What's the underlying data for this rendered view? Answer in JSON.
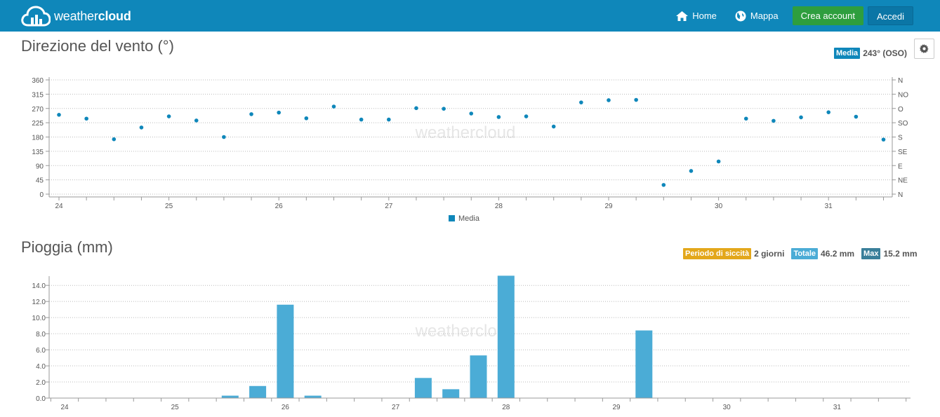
{
  "nav": {
    "brand_light": "weather",
    "brand_bold": "cloud",
    "home_label": "Home",
    "map_label": "Mappa",
    "create_label": "Crea account",
    "login_label": "Accedi"
  },
  "wind": {
    "title": "Direzione del vento (°)",
    "badge_label": "Media",
    "badge_value": "243° (OSO)",
    "badge_color": "#0f87ba"
  },
  "rain": {
    "title": "Pioggia (mm)",
    "dry_label": "Periodo di siccità",
    "dry_value": "2 giorni",
    "dry_color": "#e3a71b",
    "total_label": "Totale",
    "total_value": "46.2 mm",
    "total_color": "#4bacd6",
    "max_label": "Max",
    "max_value": "15.2 mm",
    "max_color": "#3a7f9a"
  },
  "watermark": "weathercloud",
  "chart_data": [
    {
      "type": "scatter",
      "x_ticks": [
        "24",
        "25",
        "26",
        "27",
        "28",
        "29",
        "30",
        "31"
      ],
      "y_ticks": [
        0,
        45,
        90,
        135,
        180,
        225,
        270,
        315,
        360
      ],
      "y2_ticks": [
        "N",
        "NE",
        "E",
        "SE",
        "S",
        "SO",
        "O",
        "NO",
        "N"
      ],
      "ylim": [
        0,
        360
      ],
      "xlim": [
        24,
        31.6
      ],
      "grid": true,
      "legend": "bottom-center",
      "series": [
        {
          "name": "Media",
          "color": "#0f87ba",
          "x": [
            24,
            24.25,
            24.5,
            24.75,
            25,
            25.25,
            25.5,
            25.75,
            26,
            26.25,
            26.5,
            26.75,
            27,
            27.25,
            27.5,
            27.75,
            28,
            28.25,
            28.5,
            28.75,
            29,
            29.25,
            29.5,
            29.75,
            30,
            30.25,
            30.5,
            30.75,
            31,
            31.25,
            31.5
          ],
          "y": [
            250,
            238,
            173,
            210,
            245,
            232,
            180,
            252,
            257,
            239,
            276,
            235,
            235,
            271,
            269,
            254,
            243,
            245,
            213,
            289,
            296,
            297,
            29,
            73,
            103,
            238,
            231,
            242,
            258,
            244,
            172
          ]
        }
      ]
    },
    {
      "type": "bar",
      "x_ticks": [
        "24",
        "25",
        "26",
        "27",
        "28",
        "29",
        "30",
        "31"
      ],
      "y_ticks": [
        "0.0",
        "2.0",
        "4.0",
        "6.0",
        "8.0",
        "10.0",
        "12.0",
        "14.0"
      ],
      "ylim": [
        0,
        14.8
      ],
      "xlim": [
        24,
        31.7
      ],
      "grid": true,
      "series": [
        {
          "color": "#4bacd6",
          "x": [
            25.5,
            25.75,
            26,
            26.25,
            27.25,
            27.5,
            27.75,
            28,
            29.25
          ],
          "values": [
            0.3,
            1.5,
            11.6,
            0.3,
            2.5,
            1.1,
            5.3,
            15.2,
            8.4
          ]
        }
      ]
    }
  ]
}
